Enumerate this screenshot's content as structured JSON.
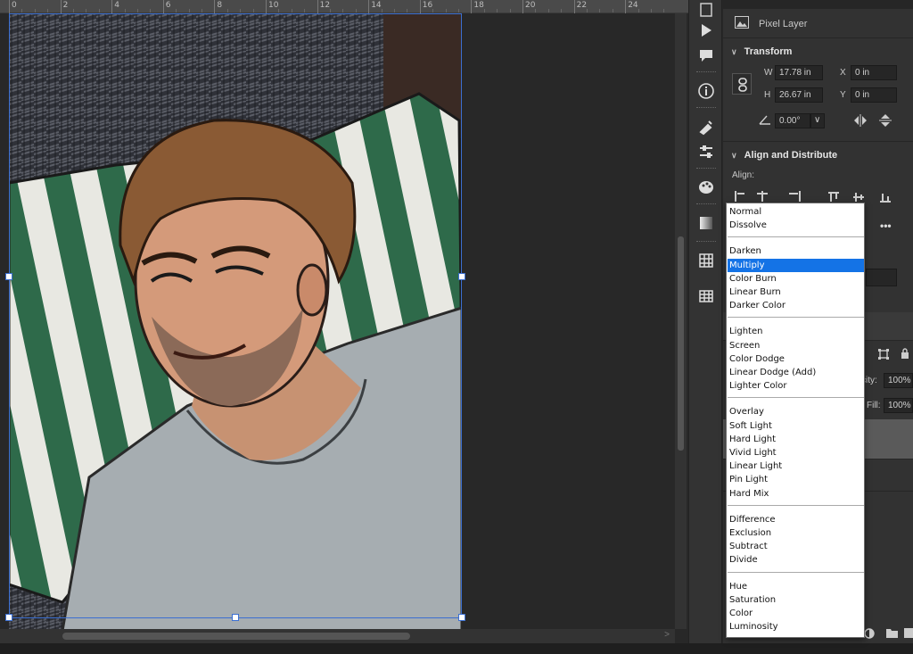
{
  "ruler": {
    "ticks": [
      "0",
      "2",
      "4",
      "6",
      "8",
      "10",
      "12",
      "14",
      "16",
      "18",
      "20",
      "22",
      "24"
    ]
  },
  "properties": {
    "layer_type": "Pixel Layer",
    "transform_header": "Transform",
    "w_label": "W",
    "w_value": "17.78 in",
    "h_label": "H",
    "h_value": "26.67 in",
    "x_label": "X",
    "x_value": "0 in",
    "y_label": "Y",
    "y_value": "0 in",
    "angle_value": "0.00°",
    "align_header": "Align and Distribute",
    "align_label": "Align:",
    "more_label": "•••"
  },
  "layers": {
    "opacity_label": "city:",
    "opacity_value": "100%",
    "fill_label": "Fill:",
    "fill_value": "100%"
  },
  "blend_menu": {
    "selected": "Multiply",
    "groups": [
      [
        "Normal",
        "Dissolve"
      ],
      [
        "Darken",
        "Multiply",
        "Color Burn",
        "Linear Burn",
        "Darker Color"
      ],
      [
        "Lighten",
        "Screen",
        "Color Dodge",
        "Linear Dodge (Add)",
        "Lighter Color"
      ],
      [
        "Overlay",
        "Soft Light",
        "Hard Light",
        "Vivid Light",
        "Linear Light",
        "Pin Light",
        "Hard Mix"
      ],
      [
        "Difference",
        "Exclusion",
        "Subtract",
        "Divide"
      ],
      [
        "Hue",
        "Saturation",
        "Color",
        "Luminosity"
      ]
    ]
  },
  "colors": {
    "accent": "#1473e6",
    "panel": "#323232",
    "canvas": "#282828",
    "selection": "#3b6fd1"
  }
}
